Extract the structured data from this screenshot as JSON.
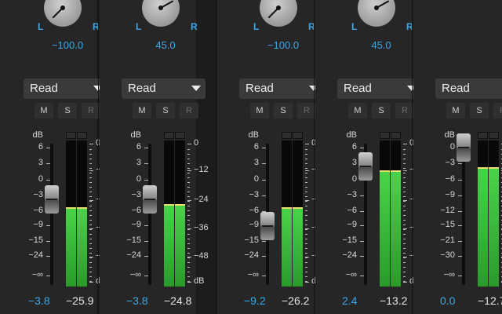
{
  "channels": [
    {
      "pan_value": "−100.0",
      "pan_fraction": -1.0,
      "automation_mode": "Read",
      "fader_db": "−3.8",
      "meter_db": "−25.9",
      "meter_level": 0.54,
      "left_labels": [
        "dB",
        "6",
        "3",
        "0",
        "−3",
        "−6",
        "−9",
        "−15",
        "−24",
        "−∞"
      ]
    },
    {
      "pan_value": "45.0",
      "pan_fraction": 0.45,
      "automation_mode": "Read",
      "fader_db": "−3.8",
      "meter_db": "−24.8",
      "meter_level": 0.56,
      "left_labels": [
        "dB",
        "6",
        "3",
        "0",
        "−3",
        "−6",
        "−9",
        "−15",
        "−24",
        "−∞"
      ]
    },
    {
      "pan_value": "−100.0",
      "pan_fraction": -1.0,
      "automation_mode": "Read",
      "fader_db": "−9.2",
      "meter_db": "−26.2",
      "meter_level": 0.54,
      "left_labels": [
        "dB",
        "6",
        "3",
        "0",
        "−3",
        "−6",
        "−9",
        "−15",
        "−24",
        "−∞"
      ]
    },
    {
      "pan_value": "45.0",
      "pan_fraction": 0.45,
      "automation_mode": "Read",
      "fader_db": "2.4",
      "meter_db": "−13.2",
      "meter_level": 0.79,
      "left_labels": [
        "dB",
        "6",
        "3",
        "0",
        "−3",
        "−6",
        "−9",
        "−15",
        "−24",
        "−∞"
      ]
    },
    {
      "pan_value": "",
      "pan_fraction": 0,
      "automation_mode": "Read",
      "fader_db": "0.0",
      "meter_db": "−12.7",
      "meter_level": 0.81,
      "left_labels": [
        "dB",
        "0",
        "−3",
        "−6",
        "−9",
        "−12",
        "−15",
        "−21",
        "−30",
        "−∞"
      ]
    }
  ],
  "pan_left_label": "L",
  "pan_right_label": "R",
  "mute_label": "M",
  "solo_label": "S",
  "record_label": "R",
  "meter_scale": [
    "0",
    "−12",
    "−24",
    "−36",
    "−48",
    "dB"
  ],
  "colors": {
    "accent_blue": "#3aa8e8",
    "meter_green": "#4ad44a",
    "strip_bg": "#262626"
  }
}
